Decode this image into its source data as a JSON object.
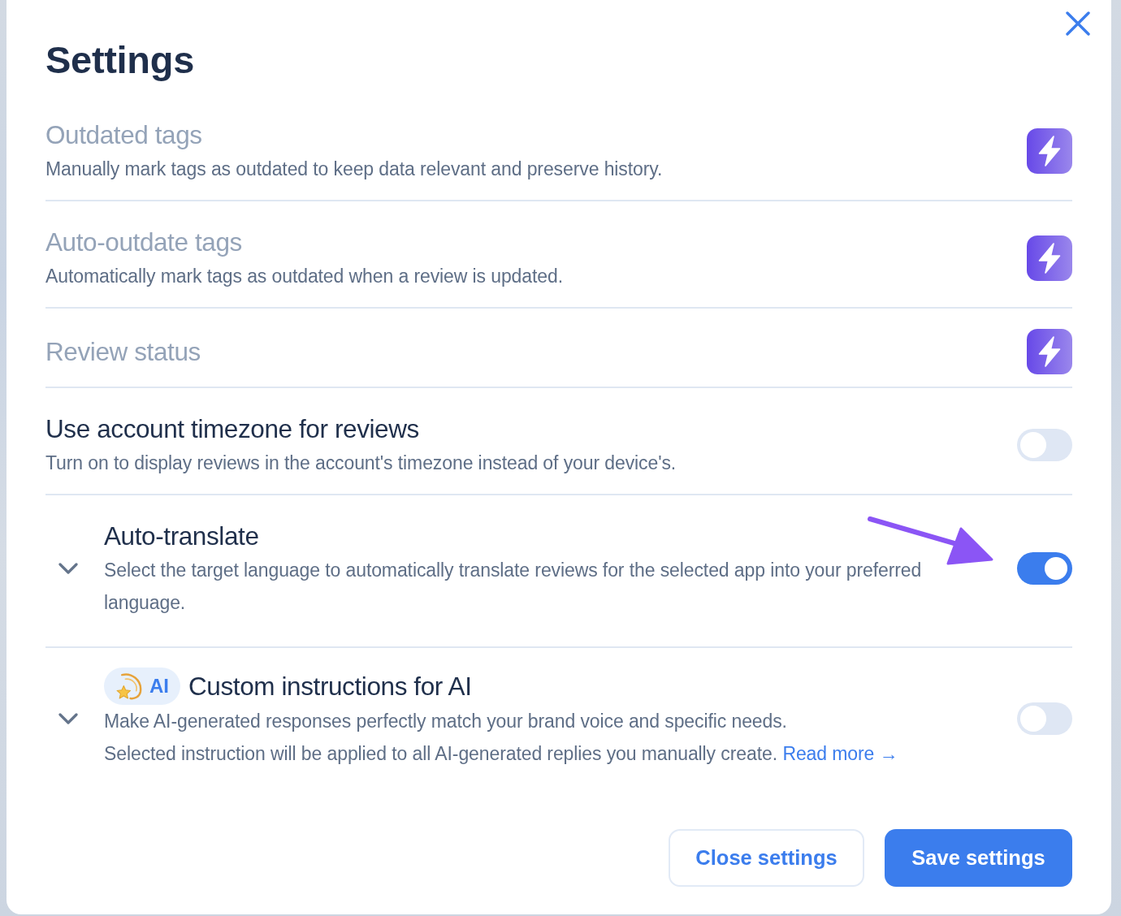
{
  "dialog": {
    "title": "Settings"
  },
  "settings": [
    {
      "kind": "locked",
      "title": "Outdated tags",
      "description": [
        "Manually mark tags as outdated to keep data relevant and preserve history."
      ],
      "annotated": false
    },
    {
      "kind": "locked",
      "title": "Auto-outdate tags",
      "description": [
        "Automatically mark tags as outdated when a review is updated."
      ],
      "annotated": false
    },
    {
      "kind": "locked",
      "title": "Review status",
      "annotated": false
    },
    {
      "kind": "toggle",
      "title": "Use account timezone for reviews",
      "description": [
        "Turn on to display reviews in the account's timezone instead of your device's."
      ],
      "on": false,
      "annotated": false
    },
    {
      "kind": "toggle",
      "title": "Auto-translate",
      "description": [
        "Select the target language to automatically translate reviews for the selected app into your preferred language."
      ],
      "on": true,
      "expanded": false,
      "annotated": true
    },
    {
      "kind": "toggle",
      "badge": {
        "text": "AI"
      },
      "title": "Custom instructions for AI",
      "description": [
        "Make AI-generated responses perfectly match your brand voice and specific needs.",
        "Selected instruction will be applied to all AI-generated replies you manually create."
      ],
      "link": {
        "text": "Read more →"
      },
      "on": false,
      "expanded": false,
      "annotated": false
    }
  ],
  "buttons": [
    {
      "kind": "secondary",
      "label": "Close settings"
    },
    {
      "kind": "primary",
      "label": "Save settings"
    }
  ]
}
